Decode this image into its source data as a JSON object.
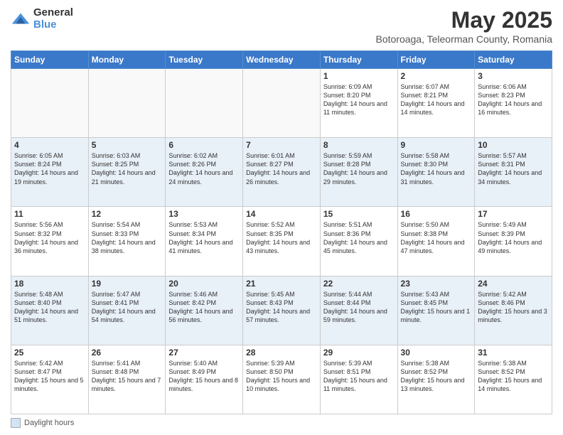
{
  "header": {
    "logo_general": "General",
    "logo_blue": "Blue",
    "title": "May 2025",
    "subtitle": "Botoroaga, Teleorman County, Romania"
  },
  "calendar": {
    "days_of_week": [
      "Sunday",
      "Monday",
      "Tuesday",
      "Wednesday",
      "Thursday",
      "Friday",
      "Saturday"
    ],
    "weeks": [
      [
        {
          "day": "",
          "info": ""
        },
        {
          "day": "",
          "info": ""
        },
        {
          "day": "",
          "info": ""
        },
        {
          "day": "",
          "info": ""
        },
        {
          "day": "1",
          "info": "Sunrise: 6:09 AM\nSunset: 8:20 PM\nDaylight: 14 hours and 11 minutes."
        },
        {
          "day": "2",
          "info": "Sunrise: 6:07 AM\nSunset: 8:21 PM\nDaylight: 14 hours and 14 minutes."
        },
        {
          "day": "3",
          "info": "Sunrise: 6:06 AM\nSunset: 8:23 PM\nDaylight: 14 hours and 16 minutes."
        }
      ],
      [
        {
          "day": "4",
          "info": "Sunrise: 6:05 AM\nSunset: 8:24 PM\nDaylight: 14 hours and 19 minutes."
        },
        {
          "day": "5",
          "info": "Sunrise: 6:03 AM\nSunset: 8:25 PM\nDaylight: 14 hours and 21 minutes."
        },
        {
          "day": "6",
          "info": "Sunrise: 6:02 AM\nSunset: 8:26 PM\nDaylight: 14 hours and 24 minutes."
        },
        {
          "day": "7",
          "info": "Sunrise: 6:01 AM\nSunset: 8:27 PM\nDaylight: 14 hours and 26 minutes."
        },
        {
          "day": "8",
          "info": "Sunrise: 5:59 AM\nSunset: 8:28 PM\nDaylight: 14 hours and 29 minutes."
        },
        {
          "day": "9",
          "info": "Sunrise: 5:58 AM\nSunset: 8:30 PM\nDaylight: 14 hours and 31 minutes."
        },
        {
          "day": "10",
          "info": "Sunrise: 5:57 AM\nSunset: 8:31 PM\nDaylight: 14 hours and 34 minutes."
        }
      ],
      [
        {
          "day": "11",
          "info": "Sunrise: 5:56 AM\nSunset: 8:32 PM\nDaylight: 14 hours and 36 minutes."
        },
        {
          "day": "12",
          "info": "Sunrise: 5:54 AM\nSunset: 8:33 PM\nDaylight: 14 hours and 38 minutes."
        },
        {
          "day": "13",
          "info": "Sunrise: 5:53 AM\nSunset: 8:34 PM\nDaylight: 14 hours and 41 minutes."
        },
        {
          "day": "14",
          "info": "Sunrise: 5:52 AM\nSunset: 8:35 PM\nDaylight: 14 hours and 43 minutes."
        },
        {
          "day": "15",
          "info": "Sunrise: 5:51 AM\nSunset: 8:36 PM\nDaylight: 14 hours and 45 minutes."
        },
        {
          "day": "16",
          "info": "Sunrise: 5:50 AM\nSunset: 8:38 PM\nDaylight: 14 hours and 47 minutes."
        },
        {
          "day": "17",
          "info": "Sunrise: 5:49 AM\nSunset: 8:39 PM\nDaylight: 14 hours and 49 minutes."
        }
      ],
      [
        {
          "day": "18",
          "info": "Sunrise: 5:48 AM\nSunset: 8:40 PM\nDaylight: 14 hours and 51 minutes."
        },
        {
          "day": "19",
          "info": "Sunrise: 5:47 AM\nSunset: 8:41 PM\nDaylight: 14 hours and 54 minutes."
        },
        {
          "day": "20",
          "info": "Sunrise: 5:46 AM\nSunset: 8:42 PM\nDaylight: 14 hours and 56 minutes."
        },
        {
          "day": "21",
          "info": "Sunrise: 5:45 AM\nSunset: 8:43 PM\nDaylight: 14 hours and 57 minutes."
        },
        {
          "day": "22",
          "info": "Sunrise: 5:44 AM\nSunset: 8:44 PM\nDaylight: 14 hours and 59 minutes."
        },
        {
          "day": "23",
          "info": "Sunrise: 5:43 AM\nSunset: 8:45 PM\nDaylight: 15 hours and 1 minute."
        },
        {
          "day": "24",
          "info": "Sunrise: 5:42 AM\nSunset: 8:46 PM\nDaylight: 15 hours and 3 minutes."
        }
      ],
      [
        {
          "day": "25",
          "info": "Sunrise: 5:42 AM\nSunset: 8:47 PM\nDaylight: 15 hours and 5 minutes."
        },
        {
          "day": "26",
          "info": "Sunrise: 5:41 AM\nSunset: 8:48 PM\nDaylight: 15 hours and 7 minutes."
        },
        {
          "day": "27",
          "info": "Sunrise: 5:40 AM\nSunset: 8:49 PM\nDaylight: 15 hours and 8 minutes."
        },
        {
          "day": "28",
          "info": "Sunrise: 5:39 AM\nSunset: 8:50 PM\nDaylight: 15 hours and 10 minutes."
        },
        {
          "day": "29",
          "info": "Sunrise: 5:39 AM\nSunset: 8:51 PM\nDaylight: 15 hours and 11 minutes."
        },
        {
          "day": "30",
          "info": "Sunrise: 5:38 AM\nSunset: 8:52 PM\nDaylight: 15 hours and 13 minutes."
        },
        {
          "day": "31",
          "info": "Sunrise: 5:38 AM\nSunset: 8:52 PM\nDaylight: 15 hours and 14 minutes."
        }
      ]
    ]
  },
  "footer": {
    "daylight_label": "Daylight hours"
  }
}
